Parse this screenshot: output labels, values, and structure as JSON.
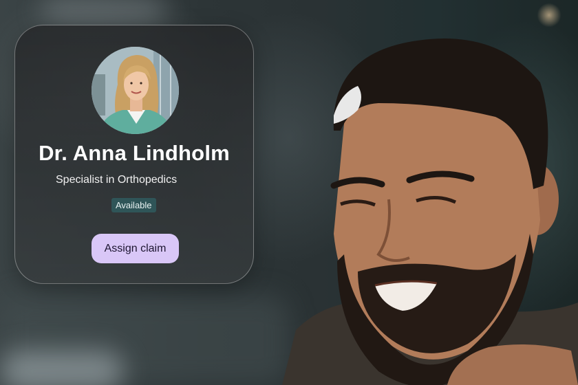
{
  "profile_card": {
    "name": "Dr. Anna Lindholm",
    "specialty": "Specialist in Orthopedics",
    "status": "Available",
    "assign_button_label": "Assign claim",
    "avatar_icon": "doctor-portrait"
  },
  "colors": {
    "button_bg": "#d9c7f7",
    "badge_bg": "#2f5558",
    "card_bg": "#2a2c2e"
  }
}
